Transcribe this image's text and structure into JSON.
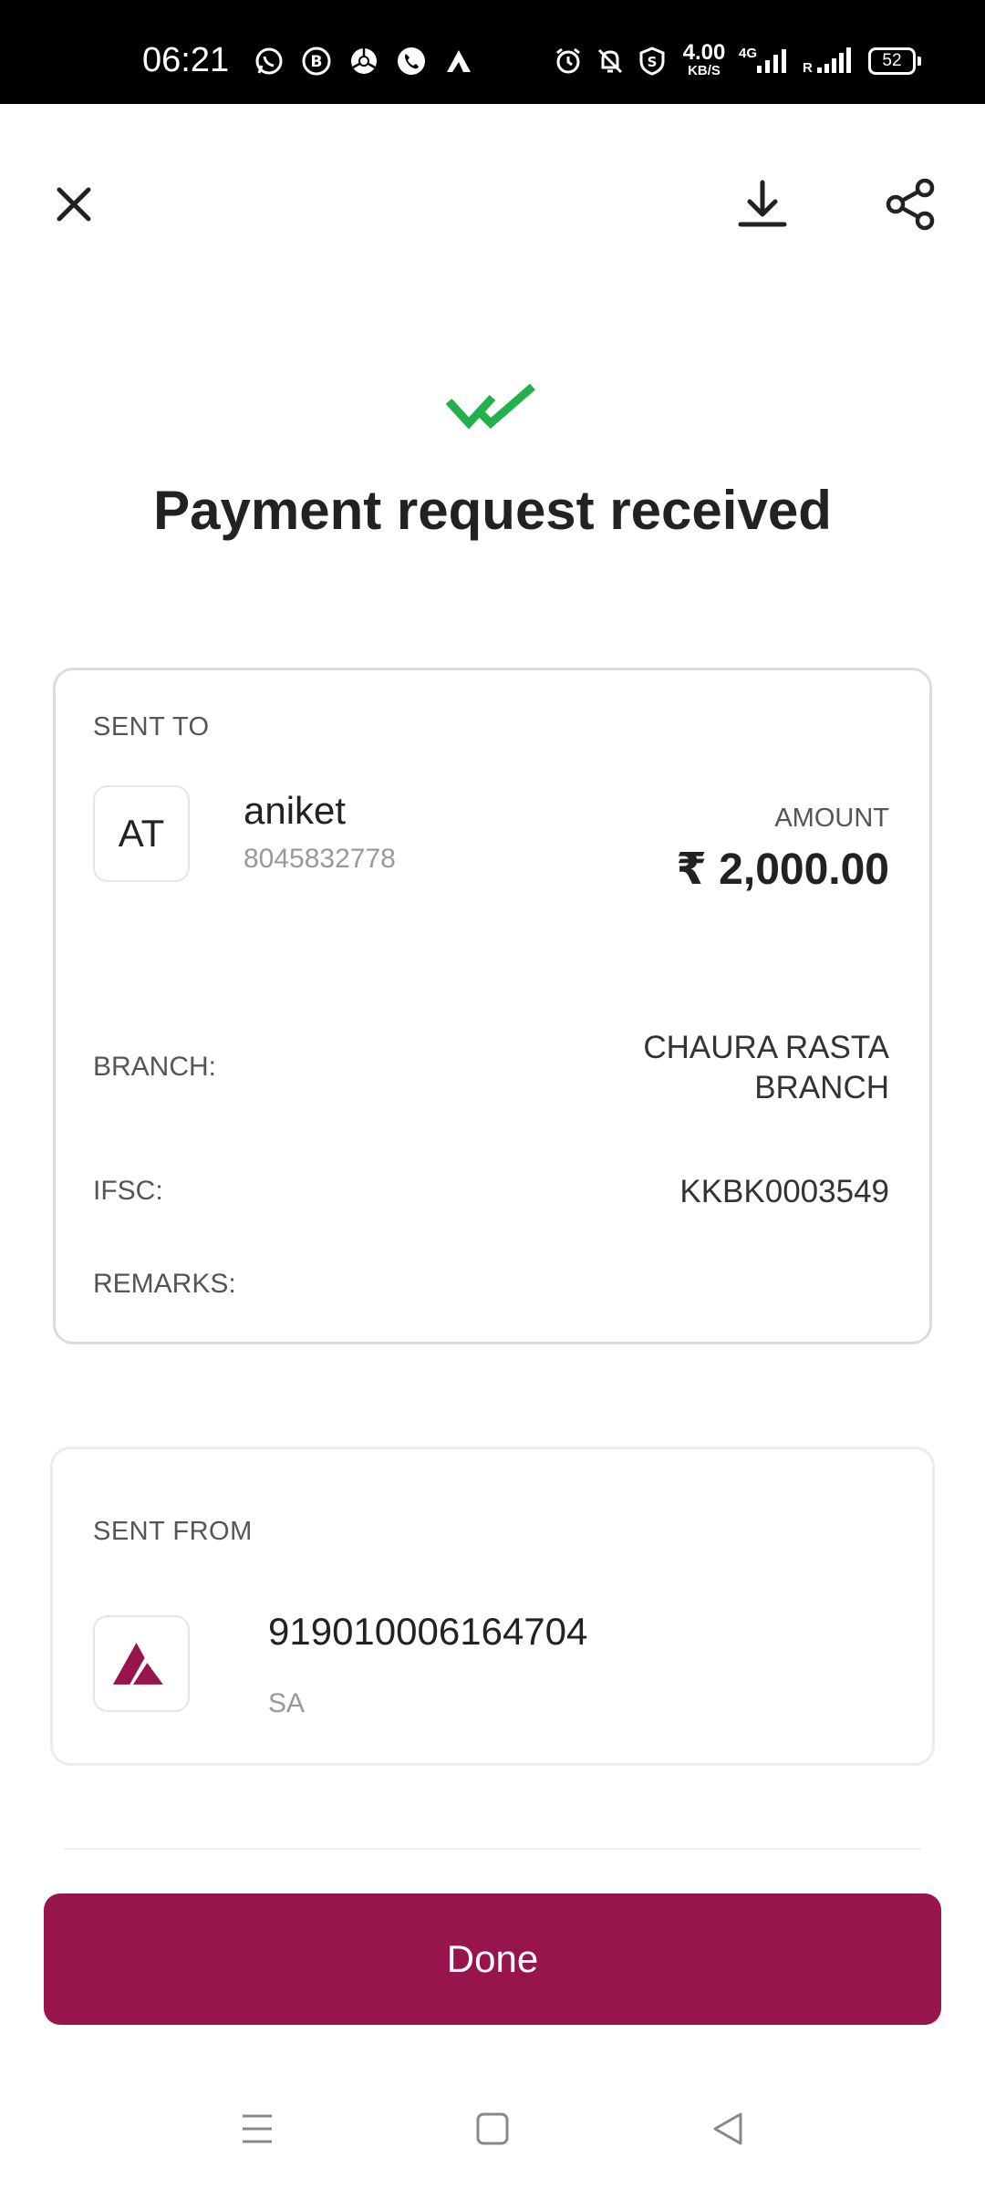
{
  "status_bar": {
    "time": "06:21",
    "net_speed_value": "4.00",
    "net_speed_unit": "KB/S",
    "network_label": "4G",
    "roaming_label": "R",
    "battery": "52"
  },
  "title": "Payment request received",
  "sent_to": {
    "label": "SENT TO",
    "avatar_initials": "AT",
    "name": "aniket",
    "phone": "8045832778",
    "amount_label": "AMOUNT",
    "amount": "₹ 2,000.00",
    "branch_label": "BRANCH:",
    "branch_line1": "CHAURA RASTA",
    "branch_line2": "BRANCH",
    "ifsc_label": "IFSC:",
    "ifsc": "KKBK0003549",
    "remarks_label": "REMARKS:"
  },
  "sent_from": {
    "label": "SENT FROM",
    "account_number": "919010006164704",
    "account_type": "SA"
  },
  "done_label": "Done",
  "colors": {
    "brand": "#97144d",
    "success": "#22b14c"
  },
  "icons": {
    "close": "close-icon",
    "download": "download-icon",
    "share": "share-icon",
    "success": "double-check-icon"
  }
}
